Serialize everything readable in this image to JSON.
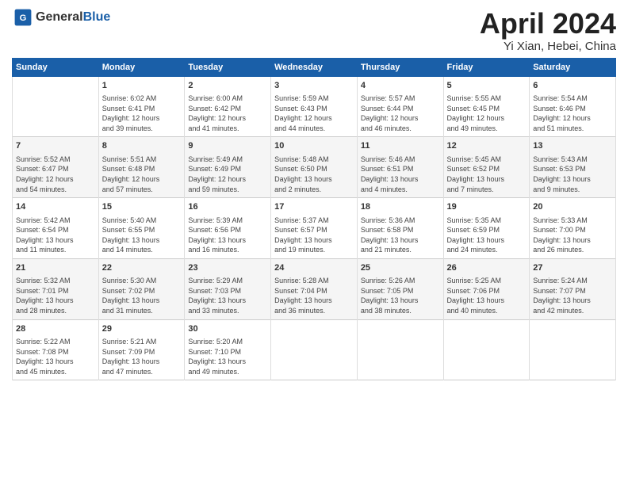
{
  "header": {
    "logo_general": "General",
    "logo_blue": "Blue",
    "title": "April 2024",
    "location": "Yi Xian, Hebei, China"
  },
  "days_of_week": [
    "Sunday",
    "Monday",
    "Tuesday",
    "Wednesday",
    "Thursday",
    "Friday",
    "Saturday"
  ],
  "weeks": [
    [
      {
        "day": "",
        "info": ""
      },
      {
        "day": "1",
        "info": "Sunrise: 6:02 AM\nSunset: 6:41 PM\nDaylight: 12 hours\nand 39 minutes."
      },
      {
        "day": "2",
        "info": "Sunrise: 6:00 AM\nSunset: 6:42 PM\nDaylight: 12 hours\nand 41 minutes."
      },
      {
        "day": "3",
        "info": "Sunrise: 5:59 AM\nSunset: 6:43 PM\nDaylight: 12 hours\nand 44 minutes."
      },
      {
        "day": "4",
        "info": "Sunrise: 5:57 AM\nSunset: 6:44 PM\nDaylight: 12 hours\nand 46 minutes."
      },
      {
        "day": "5",
        "info": "Sunrise: 5:55 AM\nSunset: 6:45 PM\nDaylight: 12 hours\nand 49 minutes."
      },
      {
        "day": "6",
        "info": "Sunrise: 5:54 AM\nSunset: 6:46 PM\nDaylight: 12 hours\nand 51 minutes."
      }
    ],
    [
      {
        "day": "7",
        "info": "Sunrise: 5:52 AM\nSunset: 6:47 PM\nDaylight: 12 hours\nand 54 minutes."
      },
      {
        "day": "8",
        "info": "Sunrise: 5:51 AM\nSunset: 6:48 PM\nDaylight: 12 hours\nand 57 minutes."
      },
      {
        "day": "9",
        "info": "Sunrise: 5:49 AM\nSunset: 6:49 PM\nDaylight: 12 hours\nand 59 minutes."
      },
      {
        "day": "10",
        "info": "Sunrise: 5:48 AM\nSunset: 6:50 PM\nDaylight: 13 hours\nand 2 minutes."
      },
      {
        "day": "11",
        "info": "Sunrise: 5:46 AM\nSunset: 6:51 PM\nDaylight: 13 hours\nand 4 minutes."
      },
      {
        "day": "12",
        "info": "Sunrise: 5:45 AM\nSunset: 6:52 PM\nDaylight: 13 hours\nand 7 minutes."
      },
      {
        "day": "13",
        "info": "Sunrise: 5:43 AM\nSunset: 6:53 PM\nDaylight: 13 hours\nand 9 minutes."
      }
    ],
    [
      {
        "day": "14",
        "info": "Sunrise: 5:42 AM\nSunset: 6:54 PM\nDaylight: 13 hours\nand 11 minutes."
      },
      {
        "day": "15",
        "info": "Sunrise: 5:40 AM\nSunset: 6:55 PM\nDaylight: 13 hours\nand 14 minutes."
      },
      {
        "day": "16",
        "info": "Sunrise: 5:39 AM\nSunset: 6:56 PM\nDaylight: 13 hours\nand 16 minutes."
      },
      {
        "day": "17",
        "info": "Sunrise: 5:37 AM\nSunset: 6:57 PM\nDaylight: 13 hours\nand 19 minutes."
      },
      {
        "day": "18",
        "info": "Sunrise: 5:36 AM\nSunset: 6:58 PM\nDaylight: 13 hours\nand 21 minutes."
      },
      {
        "day": "19",
        "info": "Sunrise: 5:35 AM\nSunset: 6:59 PM\nDaylight: 13 hours\nand 24 minutes."
      },
      {
        "day": "20",
        "info": "Sunrise: 5:33 AM\nSunset: 7:00 PM\nDaylight: 13 hours\nand 26 minutes."
      }
    ],
    [
      {
        "day": "21",
        "info": "Sunrise: 5:32 AM\nSunset: 7:01 PM\nDaylight: 13 hours\nand 28 minutes."
      },
      {
        "day": "22",
        "info": "Sunrise: 5:30 AM\nSunset: 7:02 PM\nDaylight: 13 hours\nand 31 minutes."
      },
      {
        "day": "23",
        "info": "Sunrise: 5:29 AM\nSunset: 7:03 PM\nDaylight: 13 hours\nand 33 minutes."
      },
      {
        "day": "24",
        "info": "Sunrise: 5:28 AM\nSunset: 7:04 PM\nDaylight: 13 hours\nand 36 minutes."
      },
      {
        "day": "25",
        "info": "Sunrise: 5:26 AM\nSunset: 7:05 PM\nDaylight: 13 hours\nand 38 minutes."
      },
      {
        "day": "26",
        "info": "Sunrise: 5:25 AM\nSunset: 7:06 PM\nDaylight: 13 hours\nand 40 minutes."
      },
      {
        "day": "27",
        "info": "Sunrise: 5:24 AM\nSunset: 7:07 PM\nDaylight: 13 hours\nand 42 minutes."
      }
    ],
    [
      {
        "day": "28",
        "info": "Sunrise: 5:22 AM\nSunset: 7:08 PM\nDaylight: 13 hours\nand 45 minutes."
      },
      {
        "day": "29",
        "info": "Sunrise: 5:21 AM\nSunset: 7:09 PM\nDaylight: 13 hours\nand 47 minutes."
      },
      {
        "day": "30",
        "info": "Sunrise: 5:20 AM\nSunset: 7:10 PM\nDaylight: 13 hours\nand 49 minutes."
      },
      {
        "day": "",
        "info": ""
      },
      {
        "day": "",
        "info": ""
      },
      {
        "day": "",
        "info": ""
      },
      {
        "day": "",
        "info": ""
      }
    ]
  ]
}
